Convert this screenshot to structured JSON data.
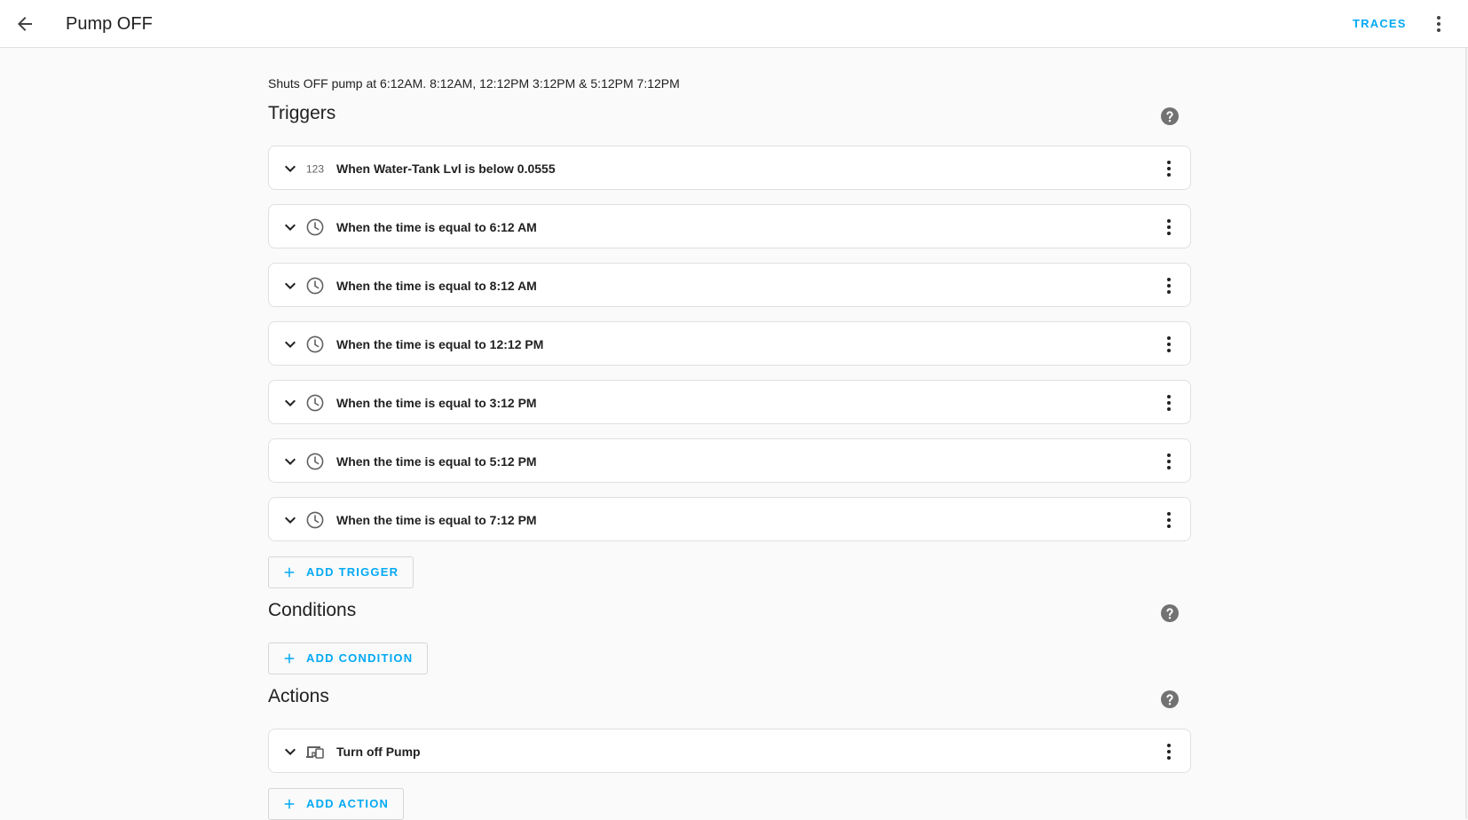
{
  "header": {
    "title": "Pump OFF",
    "traces_label": "TRACES",
    "back_icon": "arrow-left-icon",
    "menu_icon": "dots-vertical-icon"
  },
  "description": "Shuts OFF pump at 6:12AM. 8:12AM, 12:12PM 3:12PM & 5:12PM 7:12PM",
  "triggers": {
    "title": "Triggers",
    "items": [
      {
        "label": "When Water-Tank Lvl is below 0.0555",
        "icon": "numeric-icon"
      },
      {
        "label": "When the time is equal to 6:12 AM",
        "icon": "clock-icon"
      },
      {
        "label": "When the time is equal to 8:12 AM",
        "icon": "clock-icon"
      },
      {
        "label": "When the time is equal to 12:12 PM",
        "icon": "clock-icon"
      },
      {
        "label": "When the time is equal to 3:12 PM",
        "icon": "clock-icon"
      },
      {
        "label": "When the time is equal to 5:12 PM",
        "icon": "clock-icon"
      },
      {
        "label": "When the time is equal to 7:12 PM",
        "icon": "clock-icon"
      }
    ],
    "add_label": "ADD TRIGGER"
  },
  "conditions": {
    "title": "Conditions",
    "add_label": "ADD CONDITION"
  },
  "actions": {
    "title": "Actions",
    "items": [
      {
        "label": "Turn off Pump",
        "icon": "devices-icon"
      }
    ],
    "add_label": "ADD ACTION"
  },
  "colors": {
    "accent": "#03a9f4",
    "background": "#fafafa",
    "card": "#ffffff",
    "icon": "#212121",
    "help_icon": "#727272"
  }
}
